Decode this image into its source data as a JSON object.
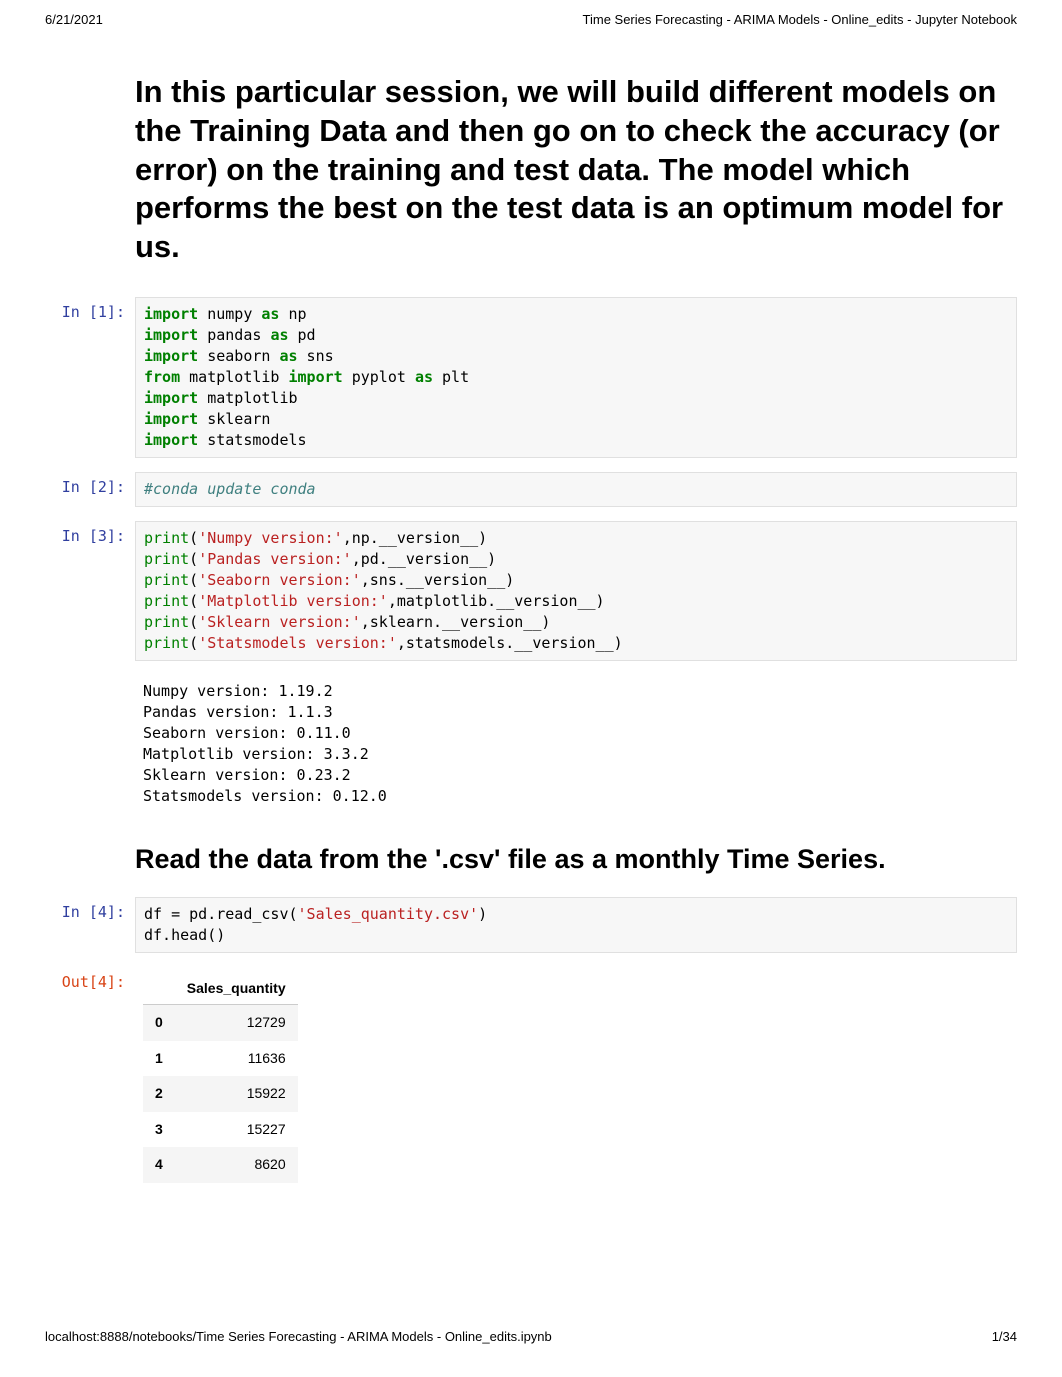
{
  "header": {
    "date": "6/21/2021",
    "title": "Time Series Forecasting - ARIMA Models - Online_edits - Jupyter Notebook"
  },
  "main_heading": "In this particular session, we will build different models on the Training Data and then go on to check the accuracy (or error) on the training and test data. The model which performs the best on the test data is an optimum model for us.",
  "cells": {
    "c1": {
      "label": "In [1]:",
      "code": {
        "l1a": "import",
        "l1b": " numpy ",
        "l1c": "as",
        "l1d": " np",
        "l2a": "import",
        "l2b": " pandas ",
        "l2c": "as",
        "l2d": " pd",
        "l3a": "import",
        "l3b": " seaborn ",
        "l3c": "as",
        "l3d": " sns",
        "l4a": "from",
        "l4b": " matplotlib ",
        "l4c": "import",
        "l4d": " pyplot ",
        "l4e": "as",
        "l4f": " plt",
        "l5a": "import",
        "l5b": " matplotlib",
        "l6a": "import",
        "l6b": " sklearn",
        "l7a": "import",
        "l7b": " statsmodels"
      }
    },
    "c2": {
      "label": "In [2]:",
      "code": {
        "l1": "#conda update conda"
      }
    },
    "c3": {
      "label": "In [3]:",
      "code": {
        "p1a": "print",
        "p1b": "(",
        "p1c": "'Numpy version:'",
        "p1d": ",np.__version__)",
        "p2a": "print",
        "p2b": "(",
        "p2c": "'Pandas version:'",
        "p2d": ",pd.__version__)",
        "p3a": "print",
        "p3b": "(",
        "p3c": "'Seaborn version:'",
        "p3d": ",sns.__version__)",
        "p4a": "print",
        "p4b": "(",
        "p4c": "'Matplotlib version:'",
        "p4d": ",matplotlib.__version__)",
        "p5a": "print",
        "p5b": "(",
        "p5c": "'Sklearn version:'",
        "p5d": ",sklearn.__version__)",
        "p6a": "print",
        "p6b": "(",
        "p6c": "'Statsmodels version:'",
        "p6d": ",statsmodels.__version__)"
      },
      "output": "Numpy version: 1.19.2\nPandas version: 1.1.3\nSeaborn version: 0.11.0\nMatplotlib version: 3.3.2\nSklearn version: 0.23.2\nStatsmodels version: 0.12.0"
    },
    "h2": "Read the data from the '.csv' file as a monthly Time Series.",
    "c4": {
      "label": "In [4]:",
      "code": {
        "l1a": "df ",
        "l1b": "=",
        "l1c": " pd.read_csv(",
        "l1d": "'Sales_quantity.csv'",
        "l1e": ")",
        "l2": "df.head()"
      }
    },
    "o4": {
      "label": "Out[4]:",
      "table": {
        "header": "Sales_quantity",
        "rows": [
          {
            "idx": "0",
            "val": "12729"
          },
          {
            "idx": "1",
            "val": "11636"
          },
          {
            "idx": "2",
            "val": "15922"
          },
          {
            "idx": "3",
            "val": "15227"
          },
          {
            "idx": "4",
            "val": "8620"
          }
        ]
      }
    }
  },
  "footer": {
    "url": "localhost:8888/notebooks/Time Series Forecasting - ARIMA Models - Online_edits.ipynb",
    "page": "1/34"
  }
}
